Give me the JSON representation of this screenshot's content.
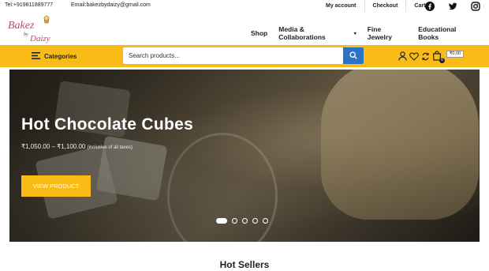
{
  "topbar": {
    "tel": "Tel:+919811889777",
    "email": "Email:bakezbydaizy@gmail.com",
    "links": [
      "My account",
      "Checkout",
      "Cart"
    ],
    "social": [
      "facebook-icon",
      "twitter-icon",
      "instagram-icon"
    ]
  },
  "logo": {
    "line1": "Bakez",
    "line2": "by",
    "line3": "Daizy"
  },
  "nav": {
    "items": [
      "Shop",
      "Media & Collaborations",
      "Fine Jewelry",
      "Educational Books"
    ]
  },
  "searchbar": {
    "categories_label": "Categories",
    "placeholder": "Search products..."
  },
  "cart": {
    "count": "0",
    "price": "₹0.00"
  },
  "hero": {
    "title": "Hot Chocolate Cubes",
    "price": "₹1,050.00 – ₹1,100.00",
    "tax_note": "(inclusive of all taxes)",
    "button": "VIEW PRODUCT",
    "slides": 5,
    "active_slide": 1
  },
  "section": {
    "title": "Hot Sellers"
  },
  "colors": {
    "accent": "#f9bc16",
    "search_button": "#2b73c9"
  }
}
